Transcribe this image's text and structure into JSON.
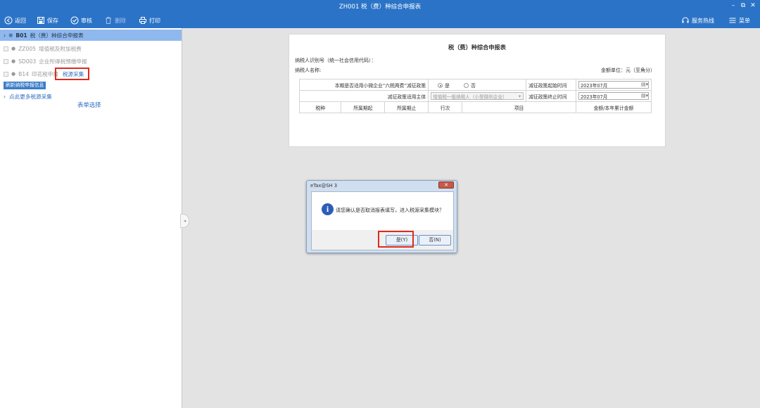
{
  "window": {
    "title": "ZH001 税（费）种综合申报表",
    "minimize": "–",
    "restore": "⧉",
    "close": "✕"
  },
  "toolbar": {
    "back": "返回",
    "save": "保存",
    "review": "审核",
    "delete": "删除",
    "print": "打印",
    "hotline": "服务热线",
    "menu": "菜单"
  },
  "sidebar": {
    "items": [
      {
        "code": "B01",
        "name": "税（费）种综合申报表",
        "selected": true
      },
      {
        "code": "ZZ005",
        "name": "增值税及附加税费"
      },
      {
        "code": "SD003",
        "name": "企业所得税预缴申报"
      },
      {
        "code": "B14",
        "name": "印花税申报",
        "link": "税源采集"
      }
    ],
    "tooltip": "刷新纳税申报信息",
    "more": "点此更多税源采集",
    "form_select": "表单选择",
    "collapse": "◂"
  },
  "form": {
    "title": "税（费）种综合申报表",
    "taxpayer_id_label": "纳税人识别号（统一社会信用代码）：",
    "taxpayer_name_label": "纳税人名称:",
    "unit": "金额单位：元（至角分）",
    "policy_label": "本期是否适用小微企业“六税两费”减征政策",
    "yes": "是",
    "no": "否",
    "start_label": "减征政策起始时间",
    "start_value": "2023年07月",
    "subject_label": "减征政策适用主体",
    "subject_value": "增值税一般纳税人（小型微利企业）",
    "end_label": "减征政策终止时间",
    "end_value": "2023年07月",
    "columns": [
      "税种",
      "所属期起",
      "所属期止",
      "行次",
      "项目",
      "金额/本年累计金额"
    ]
  },
  "dialog": {
    "title": "eTax@SH 3",
    "close": "✕",
    "message": "请您确认是否取消报表填写，进入税源采集模块？",
    "yes_button": "是(Y)",
    "no_button": "否(N)"
  }
}
